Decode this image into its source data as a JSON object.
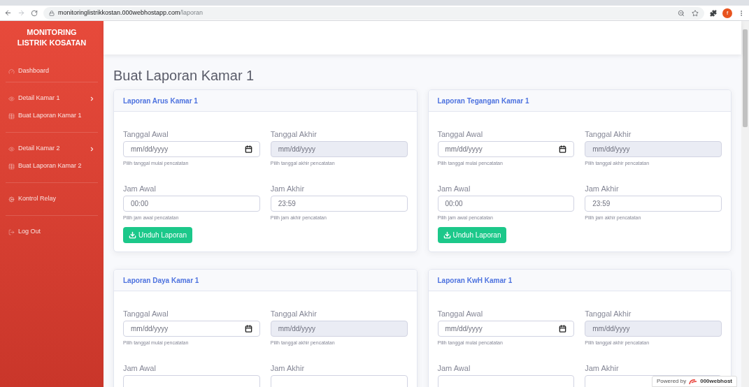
{
  "browser": {
    "url_host": "monitoringlistrikkostan.000webhostapp.com",
    "url_path": "/laporan",
    "profile_letter": "f"
  },
  "sidebar": {
    "brand": [
      "MONITORING",
      "LISTRIK KOSATAN"
    ],
    "groups": [
      [
        {
          "label": "Dashboard",
          "has_submenu": false
        }
      ],
      [
        {
          "label": "Detail Kamar 1",
          "has_submenu": true
        },
        {
          "label": "Buat Laporan Kamar 1",
          "has_submenu": false
        }
      ],
      [
        {
          "label": "Detail Kamar 2",
          "has_submenu": true
        },
        {
          "label": "Buat Laporan Kamar 2",
          "has_submenu": false
        }
      ],
      [
        {
          "label": "Kontrol Relay",
          "has_submenu": false
        }
      ],
      [
        {
          "label": "Log Out",
          "has_submenu": false
        }
      ]
    ]
  },
  "page_title": "Buat Laporan Kamar 1",
  "cards": [
    {
      "title": "Laporan Arus Kamar 1",
      "date_fields": [
        {
          "label": "Tanggal Awal",
          "placeholder": "mm/dd/yyyy",
          "disabled": false,
          "hint": "Pilih tanggal mulai pencatatan"
        },
        {
          "label": "Tanggal Akhir",
          "placeholder": "mm/dd/yyyy",
          "disabled": true,
          "hint": "Pilih tanggal akhir pencatatan"
        }
      ],
      "time_fields": [
        {
          "label": "Jam Awal",
          "value": "00:00",
          "hint": "Pilih jam awal pencatatan"
        },
        {
          "label": "Jam Akhir",
          "value": "23:59",
          "hint": "Pilih jam akhir pencatatan"
        }
      ],
      "button": "Unduh Laporan"
    },
    {
      "title": "Laporan Tegangan Kamar 1",
      "date_fields": [
        {
          "label": "Tanggal Awal",
          "placeholder": "mm/dd/yyyy",
          "disabled": false,
          "hint": "Pilih tanggal mulai pencatatan"
        },
        {
          "label": "Tanggal Akhir",
          "placeholder": "mm/dd/yyyy",
          "disabled": true,
          "hint": "Pilih tanggal akhir pencatatan"
        }
      ],
      "time_fields": [
        {
          "label": "Jam Awal",
          "value": "00:00",
          "hint": "Pilih jam awal pencatatan"
        },
        {
          "label": "Jam Akhir",
          "value": "23:59",
          "hint": "Pilih jam akhir pencatatan"
        }
      ],
      "button": "Unduh Laporan"
    },
    {
      "title": "Laporan Daya Kamar 1",
      "date_fields": [
        {
          "label": "Tanggal Awal",
          "placeholder": "mm/dd/yyyy",
          "disabled": false,
          "hint": "Pilih tanggal mulai pencatatan"
        },
        {
          "label": "Tanggal Akhir",
          "placeholder": "mm/dd/yyyy",
          "disabled": true,
          "hint": "Pilih tanggal akhir pencatatan"
        }
      ],
      "time_fields": [
        {
          "label": "Jam Awal"
        },
        {
          "label": "Jam Akhir"
        }
      ]
    },
    {
      "title": "Laporan KwH Kamar 1",
      "date_fields": [
        {
          "label": "Tanggal Awal",
          "placeholder": "mm/dd/yyyy",
          "disabled": false,
          "hint": "Pilih tanggal mulai pencatatan"
        },
        {
          "label": "Tanggal Akhir",
          "placeholder": "mm/dd/yyyy",
          "disabled": true,
          "hint": "Pilih tanggal akhir pencatatan"
        }
      ],
      "time_fields": [
        {
          "label": "Jam Awal"
        },
        {
          "label": "Jam Akhir"
        }
      ]
    }
  ],
  "badge": {
    "prefix": "Powered by",
    "brand": "000webhost"
  }
}
